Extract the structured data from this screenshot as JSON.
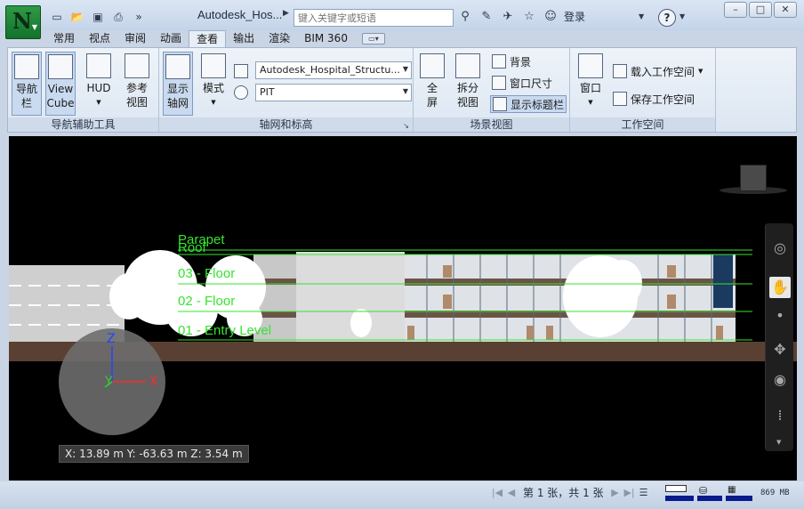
{
  "titlebar": {
    "app_letter": "N",
    "doc_title": "Autodesk_Hos...",
    "search_placeholder": "键入关键字或短语",
    "login_label": "登录",
    "help_label": "?",
    "window_controls": [
      "–",
      "□",
      "✕"
    ],
    "qat_icons": [
      "new-icon",
      "open-icon",
      "save-icon",
      "print-icon",
      "more-icon"
    ]
  },
  "tabs": [
    {
      "label": "常用",
      "active": false
    },
    {
      "label": "视点",
      "active": false
    },
    {
      "label": "审阅",
      "active": false
    },
    {
      "label": "动画",
      "active": false
    },
    {
      "label": "查看",
      "active": true
    },
    {
      "label": "输出",
      "active": false
    },
    {
      "label": "渲染",
      "active": false
    },
    {
      "label": "BIM 360",
      "active": false
    }
  ],
  "ribbon": {
    "nav_panel": {
      "title": "导航辅助工具",
      "buttons": [
        {
          "line1": "导航",
          "line2": "栏"
        },
        {
          "line1": "View",
          "line2": "Cube"
        },
        {
          "line1": "HUD",
          "line2": ""
        },
        {
          "line1": "参考",
          "line2": "视图"
        }
      ]
    },
    "grid_panel": {
      "title": "轴网和标高",
      "show_grid": {
        "line1": "显示",
        "line2": "轴网"
      },
      "mode": {
        "line1": "模式"
      },
      "combo1": "Autodesk_Hospital_Structu...",
      "combo2": "PIT"
    },
    "scene_panel": {
      "title": "场景视图",
      "fullscreen": {
        "line1": "全",
        "line2": "屏"
      },
      "split": {
        "line1": "拆分",
        "line2": "视图"
      },
      "background": "背景",
      "window_size": "窗口尺寸",
      "show_titlebar": "显示标题栏"
    },
    "workspace_panel": {
      "title": "工作空间",
      "window": {
        "line1": "窗口"
      },
      "load": "载入工作空间",
      "save": "保存工作空间"
    }
  },
  "viewport": {
    "levels": [
      "Parapet",
      "Roof",
      "03 - Floor",
      "02 - Floor",
      "01 - Entry Level"
    ],
    "axes": {
      "z": "Z",
      "y": "Y",
      "x": "X"
    },
    "coord_readout": "X: 13.89 m  Y: -63.63 m  Z: 3.54 m"
  },
  "statusbar": {
    "sheet_text": "第 1 张，共 1 张",
    "memory": "869 MB"
  },
  "colors": {
    "level_line": "#35e52e",
    "ground": "#5a4032",
    "accent_blue": "#0a1a8c"
  }
}
